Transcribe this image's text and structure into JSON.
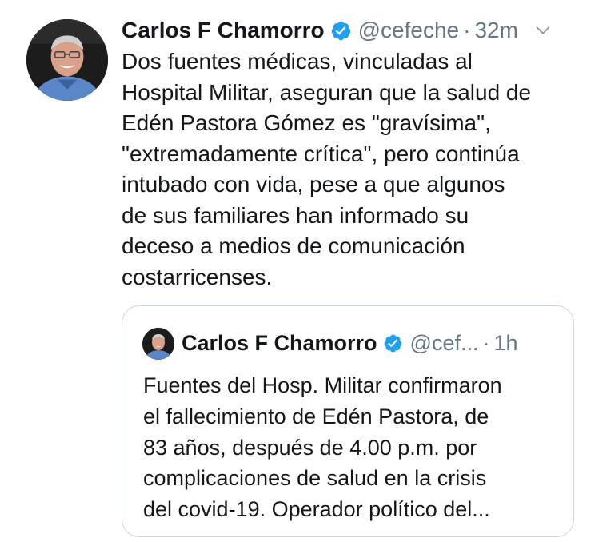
{
  "tweet": {
    "author_name": "Carlos F Chamorro",
    "handle": "@cefeche",
    "separator": "·",
    "time": "32m",
    "text_lines": [
      "Dos fuentes médicas, vinculadas al",
      "Hospital Militar, aseguran que la salud de",
      "Edén Pastora Gómez es \"gravísima\",",
      "\"extremadamente crítica\", pero continúa",
      "intubado con vida, pese a que algunos",
      "de sus familiares han informado su",
      "deceso a medios de comunicación",
      "costarricenses."
    ]
  },
  "quoted_tweet": {
    "author_name": "Carlos F Chamorro",
    "handle": "@cef...",
    "separator": "·",
    "time": "1h",
    "text_lines": [
      "Fuentes del Hosp. Militar confirmaron",
      "el fallecimiento de Edén Pastora, de",
      "83 años, después de 4.00 p.m. por",
      "complicaciones de salud en la crisis",
      "del covid-19. Operador político del..."
    ]
  },
  "icons": {
    "verified": "verified-badge-icon",
    "menu": "chevron-down-icon"
  },
  "colors": {
    "primary_text": "#14171a",
    "secondary_text": "#657786",
    "verified_blue": "#1da1f2",
    "border": "#ccd6dd"
  }
}
